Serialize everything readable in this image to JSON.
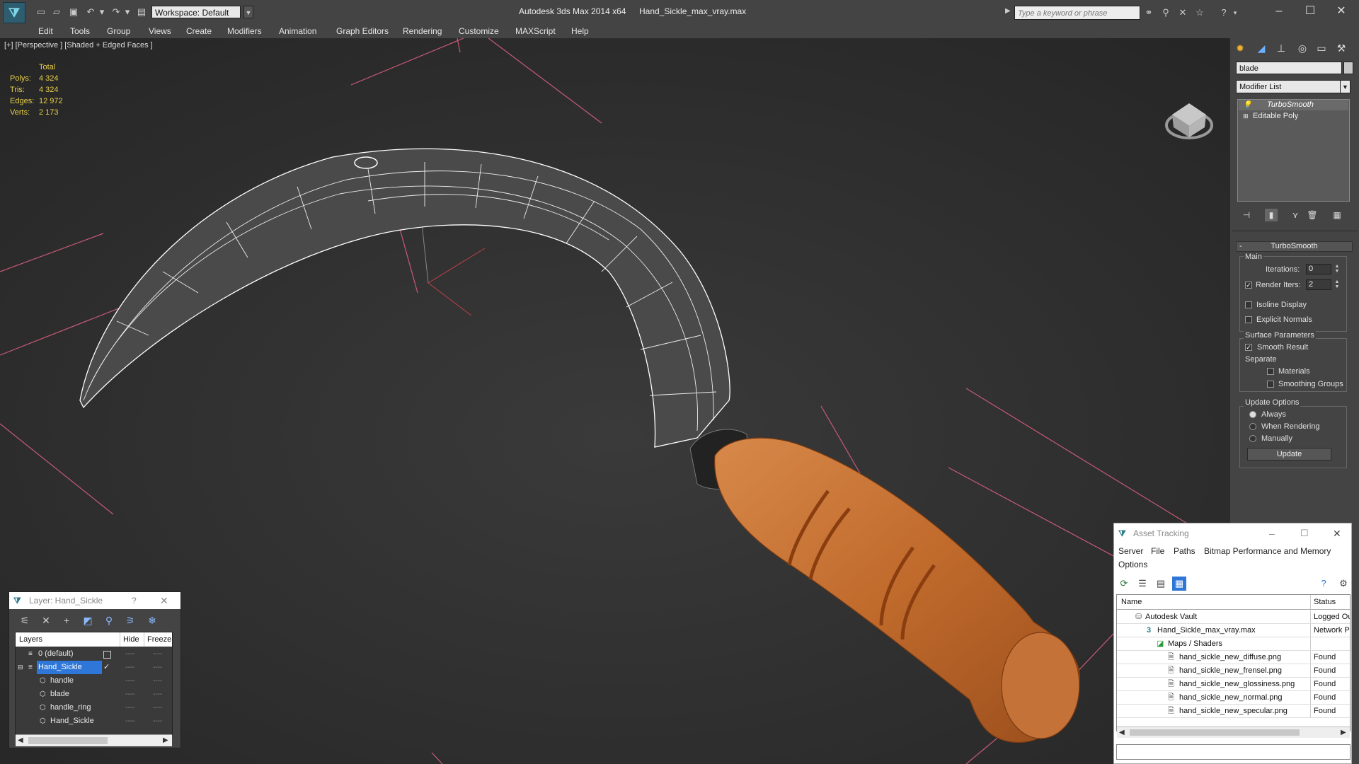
{
  "titlebar": {
    "workspace": "Workspace: Default",
    "app_title": "Autodesk 3ds Max  2014 x64",
    "file_title": "Hand_Sickle_max_vray.max",
    "search_placeholder": "Type a keyword or phrase"
  },
  "menu": [
    "Edit",
    "Tools",
    "Group",
    "Views",
    "Create",
    "Modifiers",
    "Animation",
    "Graph Editors",
    "Rendering",
    "Customize",
    "MAXScript",
    "Help"
  ],
  "viewport": {
    "label": "[+] [Perspective ] [Shaded + Edged Faces ]",
    "stats": {
      "header": "Total",
      "rows": [
        {
          "label": "Polys:",
          "value": "4 324"
        },
        {
          "label": "Tris:",
          "value": "4 324"
        },
        {
          "label": "Edges:",
          "value": "12 972"
        },
        {
          "label": "Verts:",
          "value": "2 173"
        }
      ]
    }
  },
  "command_panel": {
    "object_name": "blade",
    "modifier_list": "Modifier List",
    "stack": [
      "TurboSmooth",
      "Editable Poly"
    ],
    "turbosmooth": {
      "title": "TurboSmooth",
      "main_group": "Main",
      "iterations_label": "Iterations:",
      "iterations_value": "0",
      "render_iters_label": "Render Iters:",
      "render_iters_value": "2",
      "isoline_label": "Isoline Display",
      "explicit_label": "Explicit Normals",
      "surface_group": "Surface Parameters",
      "smooth_result_label": "Smooth Result",
      "separate_label": "Separate",
      "materials_label": "Materials",
      "smoothing_groups_label": "Smoothing Groups",
      "update_group": "Update Options",
      "always_label": "Always",
      "when_rendering_label": "When Rendering",
      "manually_label": "Manually",
      "update_button": "Update"
    }
  },
  "layer_dialog": {
    "title": "Layer: Hand_Sickle",
    "help": "?",
    "col_layers": "Layers",
    "col_hide": "Hide",
    "col_freeze": "Freeze",
    "rows": [
      {
        "name": "0 (default)"
      },
      {
        "name": "Hand_Sickle"
      },
      {
        "name": "handle"
      },
      {
        "name": "blade"
      },
      {
        "name": "handle_ring"
      },
      {
        "name": "Hand_Sickle"
      }
    ],
    "dash": "----"
  },
  "asset_tracking": {
    "title": "Asset Tracking",
    "menu": [
      "Server",
      "File",
      "Paths",
      "Bitmap Performance and Memory",
      "Options"
    ],
    "col_name": "Name",
    "col_status": "Status",
    "rows": [
      {
        "name": "Autodesk Vault",
        "status": "Logged Ou"
      },
      {
        "name": "Hand_Sickle_max_vray.max",
        "status": "Network P"
      },
      {
        "name": "Maps / Shaders",
        "status": ""
      },
      {
        "name": "hand_sickle_new_diffuse.png",
        "status": "Found"
      },
      {
        "name": "hand_sickle_new_frensel.png",
        "status": "Found"
      },
      {
        "name": "hand_sickle_new_glossiness.png",
        "status": "Found"
      },
      {
        "name": "hand_sickle_new_normal.png",
        "status": "Found"
      },
      {
        "name": "hand_sickle_new_specular.png",
        "status": "Found"
      }
    ]
  },
  "colors": {
    "viewport_bg": "#2b2b2b",
    "selection": "#2e76d8",
    "stat_yellow": "#e8d04a",
    "handle_wood": "#c8763a",
    "grid_pink": "#d06080"
  }
}
